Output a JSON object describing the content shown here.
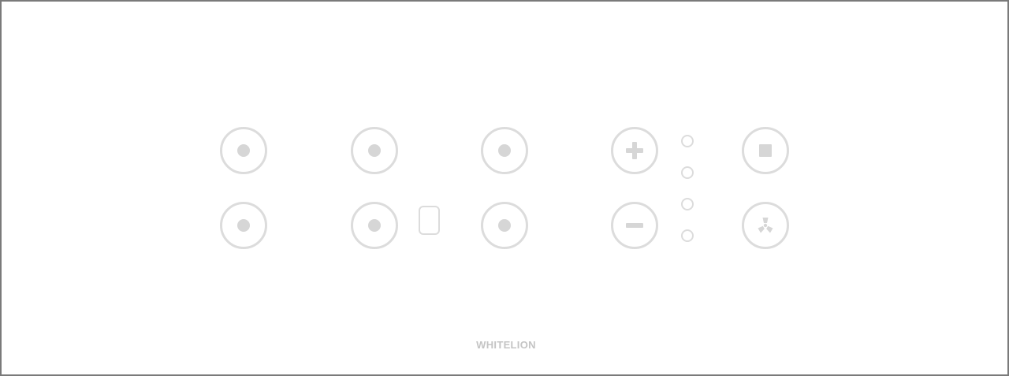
{
  "brand": {
    "label": "WHITELION"
  },
  "colors": {
    "frame_border": "#7a7a7a",
    "control_stroke": "#dcdcdc",
    "control_fill": "#d6d6d6",
    "brand_text": "#c4c4c4",
    "background": "#ffffff"
  },
  "controls": {
    "icons": {
      "switch": "dot-icon",
      "increase": "plus-icon",
      "decrease": "minus-icon",
      "master": "square-icon",
      "fan": "fan-icon"
    }
  }
}
